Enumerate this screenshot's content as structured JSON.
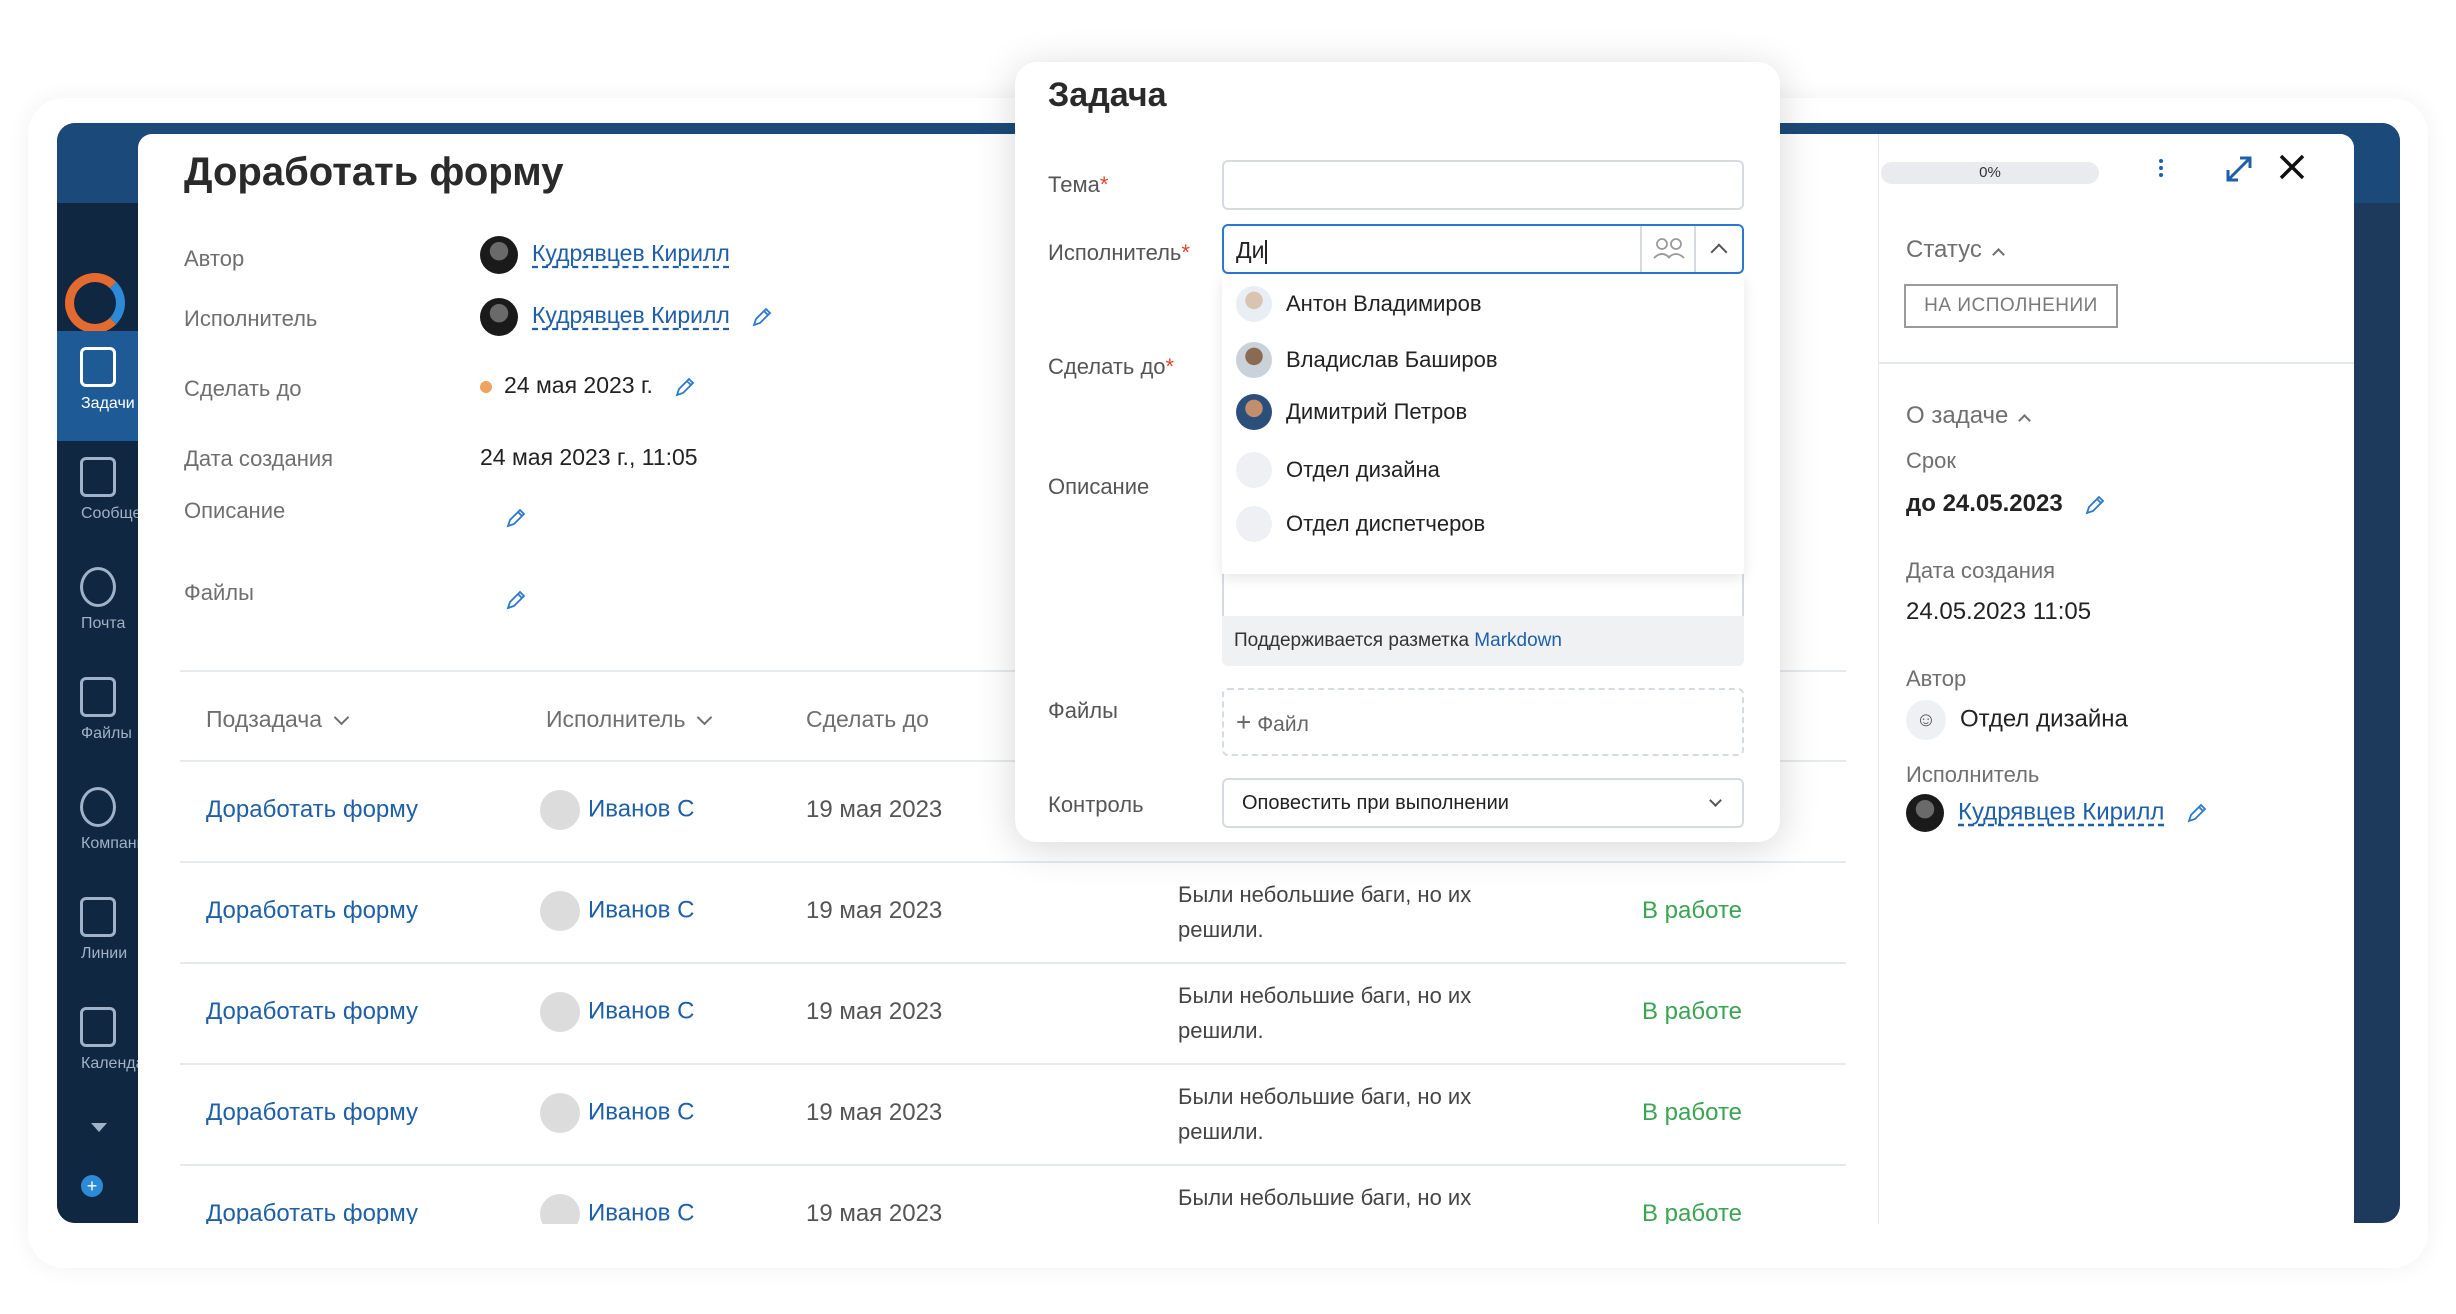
{
  "sidebar": {
    "items": [
      {
        "label": "Задачи",
        "icon": "clipboard-icon",
        "active": true
      },
      {
        "label": "Сообщения",
        "icon": "chat-icon"
      },
      {
        "label": "Почта",
        "icon": "at-icon"
      },
      {
        "label": "Файлы",
        "icon": "file-icon"
      },
      {
        "label": "Компании",
        "icon": "people-icon"
      },
      {
        "label": "Линии",
        "icon": "speech-icon"
      },
      {
        "label": "Календарь",
        "icon": "calendar-icon"
      }
    ]
  },
  "task": {
    "title": "Доработать форму",
    "fields": {
      "author_label": "Автор",
      "author": "Кудрявцев Кирилл",
      "assignee_label": "Исполнитель",
      "assignee": "Кудрявцев Кирилл",
      "due_label": "Сделать до",
      "due": "24 мая 2023 г.",
      "created_label": "Дата создания",
      "created": "24 мая 2023 г., 11:05",
      "description_label": "Описание",
      "files_label": "Файлы"
    }
  },
  "subtasks": {
    "headers": [
      "Подзадача",
      "Исполнитель",
      "Сделать до"
    ],
    "rows": [
      {
        "name": "Доработать форму",
        "assignee": "Иванов С",
        "due": "19 мая 2023",
        "desc": "",
        "status": ""
      },
      {
        "name": "Доработать форму",
        "assignee": "Иванов С",
        "due": "19 мая 2023",
        "desc": "Были небольшие баги, но их решили.",
        "status": "В работе"
      },
      {
        "name": "Доработать форму",
        "assignee": "Иванов С",
        "due": "19 мая 2023",
        "desc": "Были небольшие баги, но их решили.",
        "status": "В работе"
      },
      {
        "name": "Доработать форму",
        "assignee": "Иванов С",
        "due": "19 мая 2023",
        "desc": "Были небольшие баги, но их решили.",
        "status": "В работе"
      },
      {
        "name": "Доработать форму",
        "assignee": "Иванов С",
        "due": "19 мая 2023",
        "desc": "Были небольшие баги, но их",
        "status": "В работе"
      }
    ]
  },
  "toolbar": {
    "progress": "0%"
  },
  "aside": {
    "status_label": "Статус",
    "status_value": "НА ИСПОЛНЕНИИ",
    "about_label": "О задаче",
    "deadline_label": "Срок",
    "deadline_value": "до 24.05.2023",
    "created_label": "Дата создания",
    "created_value": "24.05.2023 11:05",
    "author_label": "Автор",
    "author_value": "Отдел дизайна",
    "assignee_label": "Исполнитель",
    "assignee_value": "Кудрявцев Кирилл"
  },
  "modal": {
    "title": "Задача",
    "topic_label": "Тема",
    "assignee_label": "Исполнитель",
    "assignee_query": "Ди",
    "due_label": "Сделать до",
    "description_label": "Описание",
    "markdown_hint": "Поддерживается разметка",
    "markdown_link": "Markdown",
    "files_label": "Файлы",
    "add_file": "Файл",
    "control_label": "Контроль",
    "control_value": "Оповестить при выполнении",
    "required_mark": "*",
    "suggestions": [
      {
        "name": "Антон Владимиров",
        "type": "person"
      },
      {
        "name": "Владислав Баширов",
        "type": "person"
      },
      {
        "name": "Димитрий Петров",
        "type": "person"
      },
      {
        "name": "Отдел дизайна",
        "type": "group"
      },
      {
        "name": "Отдел диспетчеров",
        "type": "group"
      }
    ]
  },
  "colors": {
    "accent": "#1f5fa8",
    "status_green": "#3aa452",
    "nav_bg": "#0f2740",
    "required": "#e0452b"
  }
}
